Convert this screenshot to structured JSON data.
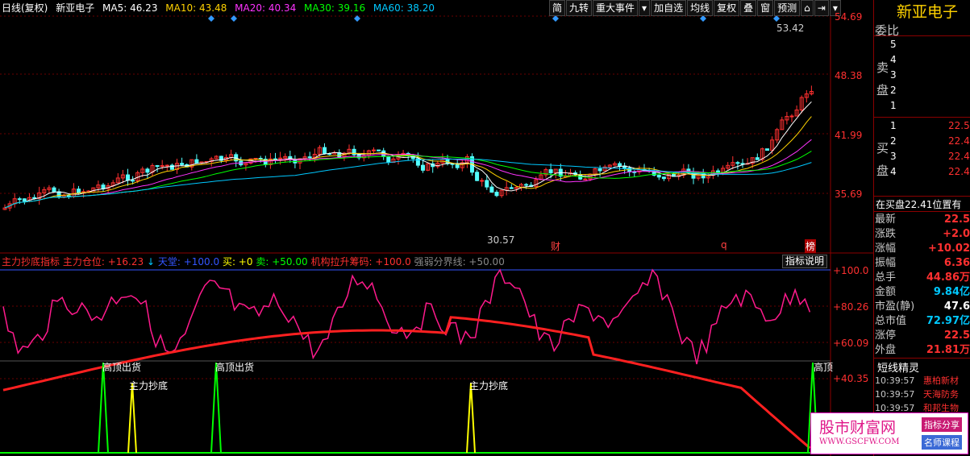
{
  "header": {
    "period": "日线(复权)",
    "stock": "新亚电子",
    "ma5": "MA5: 46.23",
    "ma10": "MA10: 43.48",
    "ma20": "MA20: 40.34",
    "ma30": "MA30: 39.16",
    "ma60": "MA60: 38.20",
    "colors": {
      "ma5": "#ffffff",
      "ma10": "#ffd200",
      "ma20": "#ff33ff",
      "ma30": "#00ff00",
      "ma60": "#00c8ff"
    }
  },
  "toolbar": [
    "简",
    "九转",
    "重大事件",
    "▾",
    "加自选",
    "均线",
    "复权",
    "叠",
    "窗",
    "预测",
    "⌂",
    "⇥",
    "▾"
  ],
  "price_axis": [
    "54.69",
    "48.38",
    "41.99",
    "35.69"
  ],
  "indicator_axis": [
    "+100.0",
    "+80.26",
    "+60.09",
    "+40.35"
  ],
  "annotations": {
    "high": "53.42",
    "low": "30.57",
    "event1": "财",
    "event2": "q",
    "event3": "榜"
  },
  "indicator": {
    "name": "主力抄底指标",
    "pos": "主力仓位: +16.23",
    "sky": "天堂: +100.0",
    "buy": "买: +0",
    "sell": "卖: +50.00",
    "lift": "机构拉升筹码: +100.0",
    "line": "强弱分界线: +50.00",
    "btn": "指标说明",
    "labels": [
      "高顶出货",
      "主力抄底",
      "高顶出货",
      "主力抄底",
      "高顶"
    ]
  },
  "panel": {
    "title": "新亚电子",
    "wei": "委比",
    "sell_label": "卖盘",
    "buy_label": "买盘",
    "sell_levels": [
      "5",
      "4",
      "3",
      "2",
      "1"
    ],
    "buy_levels": [
      "1",
      "2",
      "3",
      "4"
    ],
    "buy_prices": [
      "22.5",
      "22.4",
      "22.4",
      "22.4"
    ],
    "note": "在买盘22.41位置有",
    "stats": [
      {
        "k": "最新",
        "v": "22.5"
      },
      {
        "k": "涨跌",
        "v": "+2.0"
      },
      {
        "k": "涨幅",
        "v": "+10.02"
      },
      {
        "k": "振幅",
        "v": "6.36"
      },
      {
        "k": "总手",
        "v": "44.86万"
      },
      {
        "k": "金额",
        "v": "9.84亿"
      },
      {
        "k": "市盈(静)",
        "v": "47.6"
      },
      {
        "k": "总市值",
        "v": "72.97亿"
      },
      {
        "k": "涨停",
        "v": "22.5"
      },
      {
        "k": "外盘",
        "v": "21.81万"
      }
    ],
    "sprite_title": "短线精灵",
    "sprite": [
      {
        "t": "10:39:57",
        "n": "惠柏新材"
      },
      {
        "t": "10:39:57",
        "n": "天海防务"
      },
      {
        "t": "10:39:57",
        "n": "和邦生物"
      }
    ]
  },
  "watermark": {
    "title": "股市财富网",
    "url": "WWW.GSCFW.COM",
    "tag1": "指标分享",
    "tag2": "名师课程"
  }
}
